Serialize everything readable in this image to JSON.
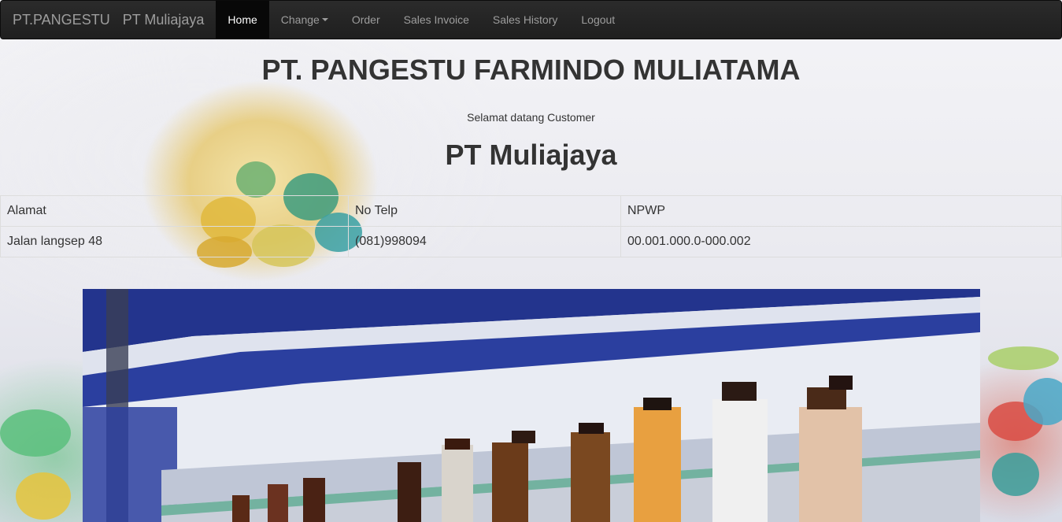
{
  "navbar": {
    "brand": "PT.PANGESTU",
    "company": "PT Muliajaya",
    "items": [
      {
        "label": "Home",
        "active": true
      },
      {
        "label": "Change",
        "dropdown": true
      },
      {
        "label": "Order"
      },
      {
        "label": "Sales Invoice"
      },
      {
        "label": "Sales History"
      },
      {
        "label": "Logout"
      }
    ]
  },
  "main": {
    "title": "PT. PANGESTU FARMINDO MULIATAMA",
    "welcome": "Selamat datang Customer",
    "company_name": "PT Muliajaya"
  },
  "info_table": {
    "headers": [
      "Alamat",
      "No Telp",
      "NPWP"
    ],
    "row": [
      "Jalan langsep 48",
      "(081)998094",
      "00.001.000.0-000.002"
    ]
  },
  "colors": {
    "navbar_bg": "#222222",
    "active_bg": "#080808",
    "nav_text": "#9d9d9d",
    "shelf_blue": "#2a3d9a"
  },
  "images": {
    "background": "medicine-pills-background",
    "banner": "pharmacy-shelf-bottles-photo"
  }
}
